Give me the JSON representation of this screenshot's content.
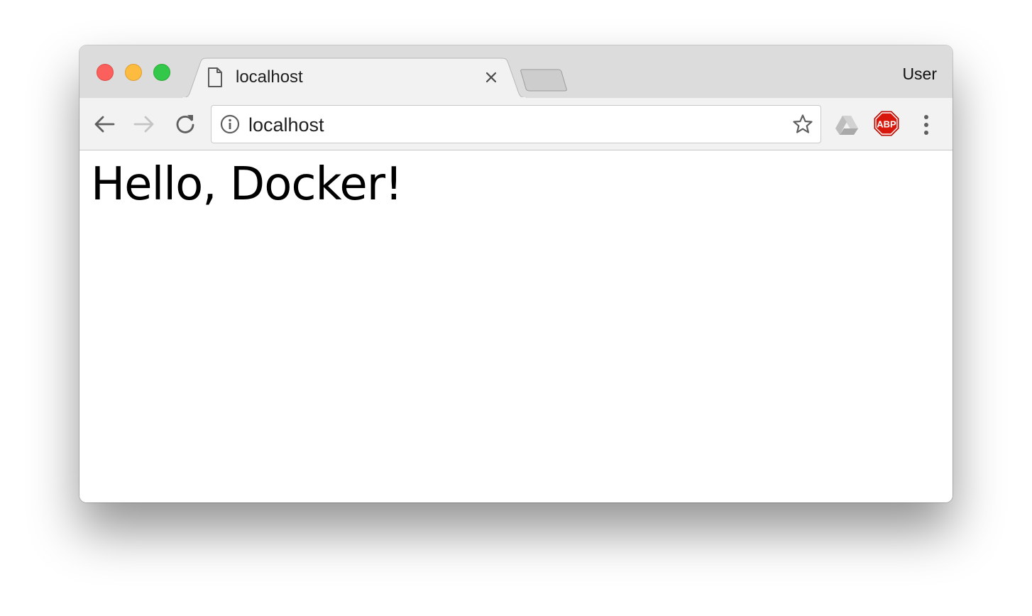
{
  "window": {
    "traffic_lights": [
      "close",
      "minimize",
      "zoom"
    ]
  },
  "tabs": [
    {
      "title": "localhost",
      "icon": "page-icon",
      "active": true
    }
  ],
  "profile": {
    "label": "User"
  },
  "toolbar": {
    "back_icon": "arrow-left-icon",
    "forward_icon": "arrow-right-icon",
    "reload_icon": "reload-icon",
    "url": "localhost",
    "security_icon": "info-icon",
    "bookmark_icon": "star-icon",
    "extensions": [
      {
        "name": "google-drive-icon"
      },
      {
        "name": "adblock-plus-icon",
        "label": "ABP",
        "color": "#d9180d"
      }
    ],
    "menu_icon": "vertical-dots-icon"
  },
  "page": {
    "heading": "Hello, Docker!"
  },
  "colors": {
    "titlebar": "#dcdcdc",
    "toolbar": "#f2f2f2",
    "close": "#fc605c",
    "minimize": "#fdbc40",
    "zoom": "#34c84a"
  }
}
